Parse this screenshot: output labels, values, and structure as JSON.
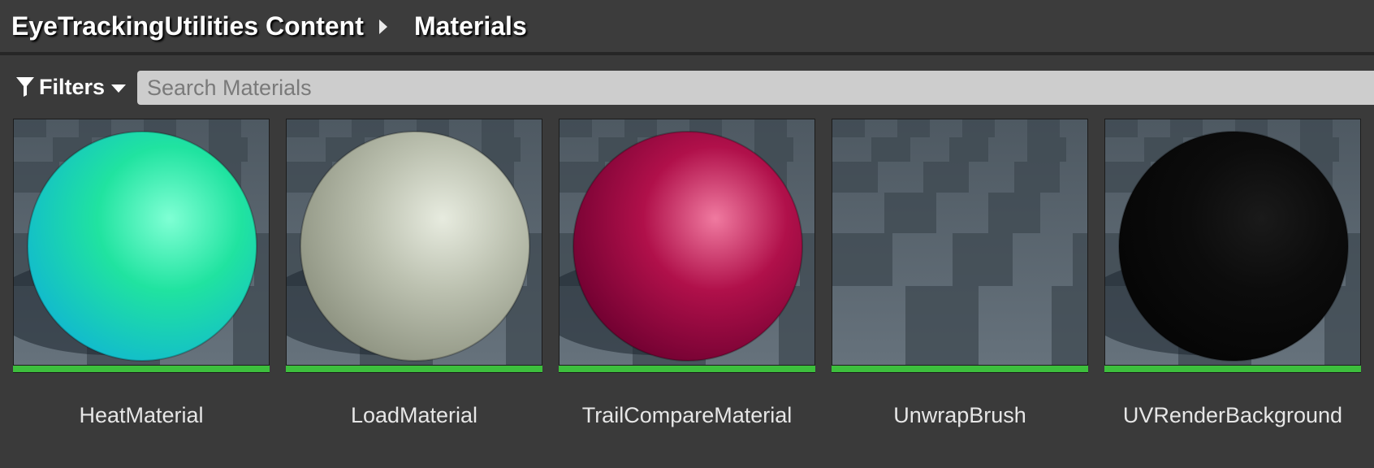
{
  "breadcrumb": {
    "root": "EyeTrackingUtilities Content",
    "current": "Materials"
  },
  "toolbar": {
    "filters_label": "Filters",
    "search_placeholder": "Search Materials"
  },
  "assets": [
    {
      "name": "HeatMaterial",
      "type": "material",
      "sphere": true,
      "colors": [
        "#7fffd4",
        "#20e3a0",
        "#11b8d0"
      ]
    },
    {
      "name": "LoadMaterial",
      "type": "material",
      "sphere": true,
      "colors": [
        "#e7ebdf",
        "#bcc1b0",
        "#8c917f"
      ]
    },
    {
      "name": "TrailCompareMaterial",
      "type": "material",
      "sphere": true,
      "colors": [
        "#f07aa0",
        "#b0104a",
        "#6e0030"
      ]
    },
    {
      "name": "UnwrapBrush",
      "type": "material",
      "sphere": false,
      "colors": [
        "#000000",
        "#000000",
        "#000000"
      ]
    },
    {
      "name": "UVRenderBackground",
      "type": "material",
      "sphere": true,
      "colors": [
        "#1a1a1a",
        "#0c0c0c",
        "#050505"
      ]
    }
  ],
  "colors": {
    "asset_type_bar": "#3dbf3d",
    "background": "#3a3a3a",
    "search_bg": "#cdcdcd"
  }
}
